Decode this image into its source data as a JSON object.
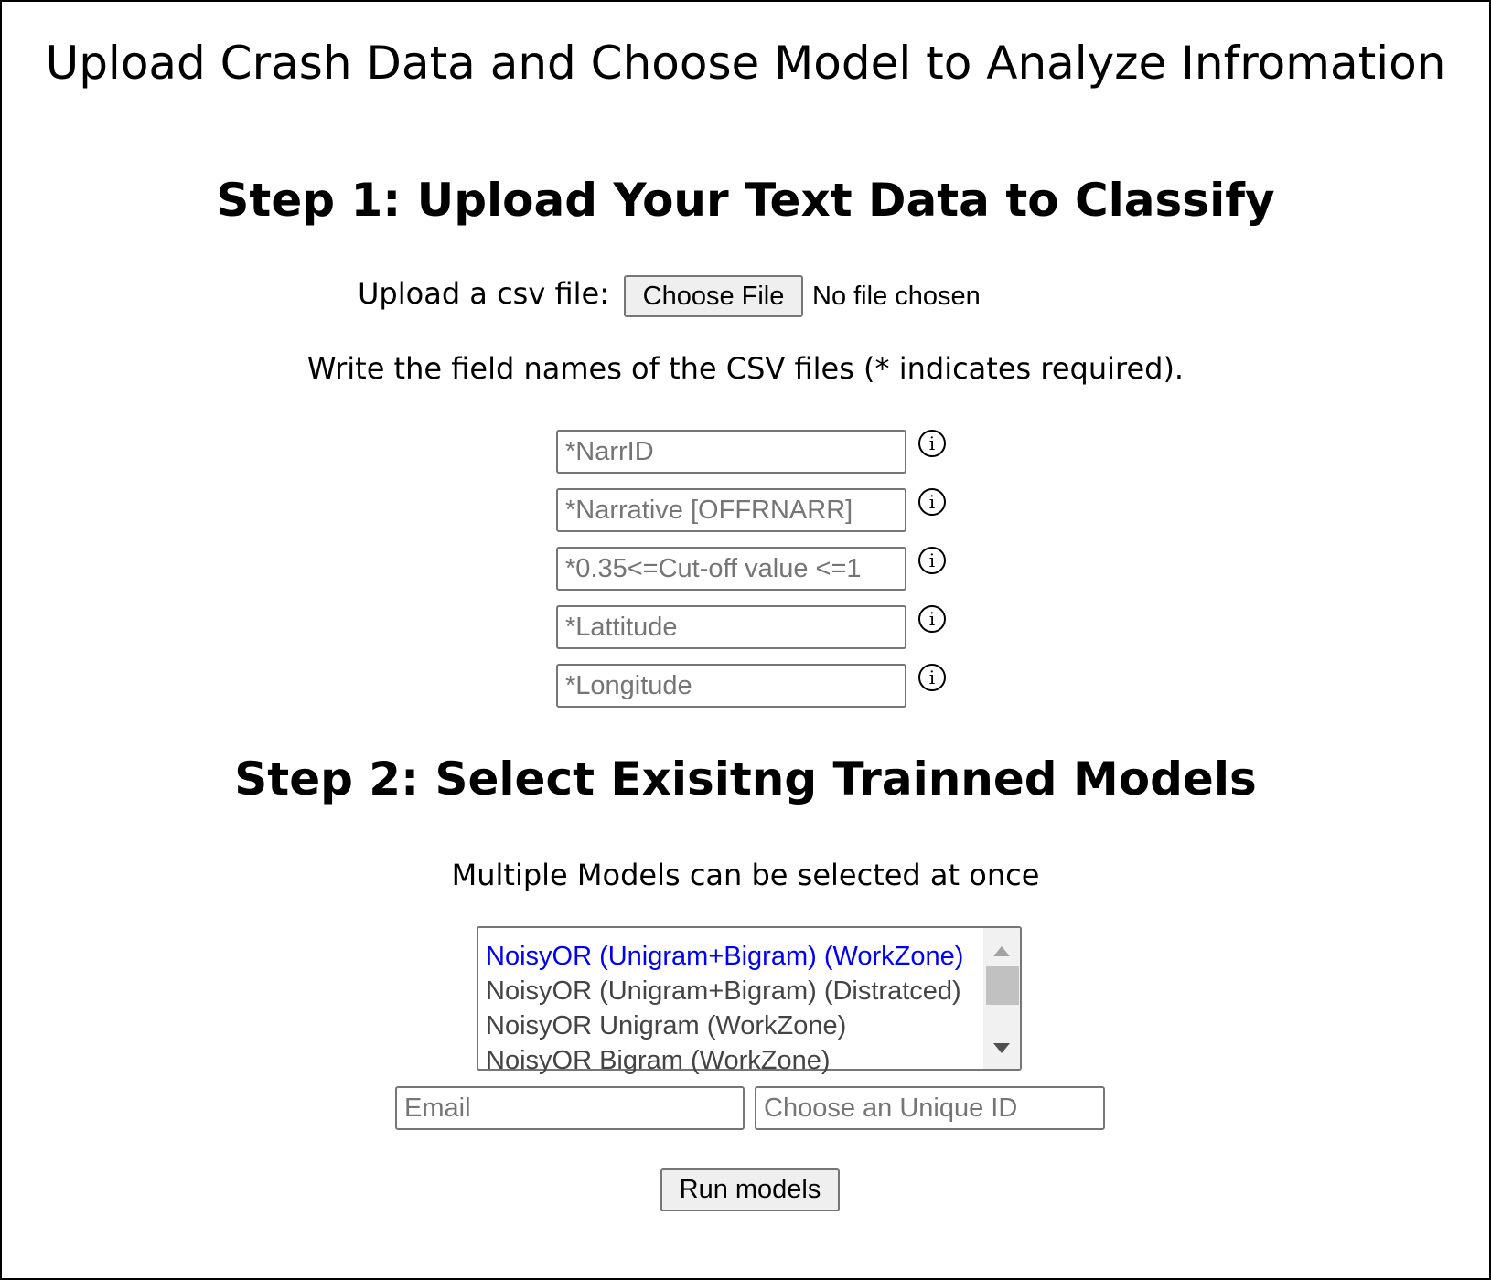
{
  "page": {
    "title": "Upload Crash Data and Choose Model to Analyze Infromation"
  },
  "step1": {
    "heading": "Step 1: Upload Your Text Data to Classify",
    "upload_label": "Upload a csv file:",
    "choose_file_label": "Choose File",
    "no_file_text": "No file chosen",
    "instructions": "Write the field names of the CSV files (* indicates required).",
    "fields": [
      {
        "placeholder": "*NarrID",
        "info_icon": "info-icon"
      },
      {
        "placeholder": "*Narrative [OFFRNARR]",
        "info_icon": "info-icon"
      },
      {
        "placeholder": "*0.35<=Cut-off value <=1",
        "info_icon": "info-icon"
      },
      {
        "placeholder": "*Lattitude",
        "info_icon": "info-icon"
      },
      {
        "placeholder": "*Longitude",
        "info_icon": "info-icon"
      }
    ],
    "info_glyph": "i"
  },
  "step2": {
    "heading": "Step 2: Select Exisitng Trainned Models",
    "hint": "Multiple Models can be selected at once",
    "models": [
      {
        "label": "NoisyOR (Unigram+Bigram) (WorkZone)",
        "selected": true
      },
      {
        "label": "NoisyOR (Unigram+Bigram) (Distratced)",
        "selected": false
      },
      {
        "label": "NoisyOR Unigram (WorkZone)",
        "selected": false
      },
      {
        "label": "NoisyOR Bigram (WorkZone)",
        "selected": false
      }
    ],
    "email_placeholder": "Email",
    "unique_id_placeholder": "Choose an Unique ID",
    "run_label": "Run models"
  },
  "colors": {
    "selected_option": "#0000ee",
    "option_text": "#444444",
    "border": "#767676",
    "button_bg": "#efefef"
  }
}
